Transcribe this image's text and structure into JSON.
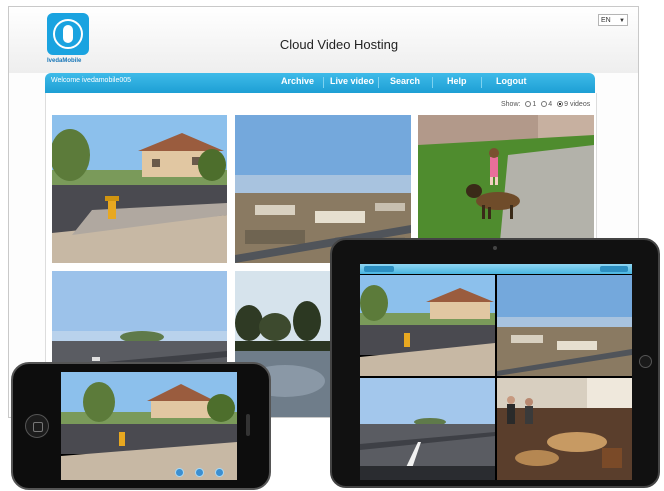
{
  "header": {
    "logo_text": "IvedaMobile",
    "title": "Cloud Video Hosting",
    "language": "EN"
  },
  "nav": {
    "welcome": "Welcome ivedamobile005",
    "items": [
      "Archive",
      "Live video",
      "Search",
      "Help",
      "Logout"
    ],
    "active_item": "Live video",
    "accent_color": "#1d9fd4"
  },
  "view_options": {
    "label": "Show:",
    "options": [
      "1",
      "4",
      "9 videos"
    ],
    "selected": "9 videos"
  },
  "desktop_grid": {
    "tiles": [
      "street-house-hydrant",
      "aerial-city-view",
      "dog-on-lawn",
      "highway",
      "pond-trees"
    ]
  },
  "tablet": {
    "tiles": [
      "street-house-hydrant",
      "aerial-city-view",
      "highway",
      "restaurant-interior"
    ],
    "toolbar_colors": [
      "#8fd6f3",
      "#4ab5e0"
    ]
  },
  "phone": {
    "tile": "street-house-hydrant",
    "controls": [
      "camera-icon",
      "settings-icon",
      "info-icon"
    ]
  }
}
